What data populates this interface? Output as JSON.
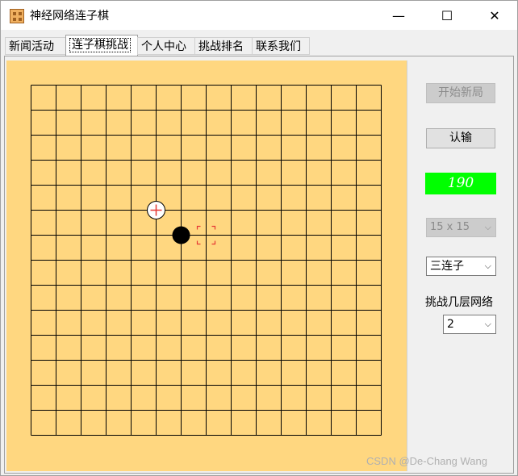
{
  "window": {
    "title": "神经网络连子棋",
    "minimize_symbol": "—",
    "maximize_symbol": "☐",
    "close_symbol": "✕",
    "app_icon": "grid-board-icon"
  },
  "tabs": [
    {
      "label": "新闻活动",
      "active": false
    },
    {
      "label": "连子棋挑战",
      "active": true
    },
    {
      "label": "个人中心",
      "active": false
    },
    {
      "label": "挑战排名",
      "active": false
    },
    {
      "label": "联系我们",
      "active": false
    }
  ],
  "board": {
    "size": 15,
    "lines": 15,
    "background_color": "#ffd780",
    "stones": [
      {
        "color": "white",
        "col": 5,
        "row": 5,
        "marker": "last-move-cross"
      },
      {
        "color": "black",
        "col": 6,
        "row": 6
      }
    ],
    "cursor": {
      "col": 7,
      "row": 6,
      "color": "#e53935"
    }
  },
  "controls": {
    "new_game_label": "开始新局",
    "new_game_enabled": false,
    "resign_label": "认输",
    "resign_enabled": true,
    "status_text": "190",
    "status_color": "#00ff00",
    "board_size_select": {
      "value": "15 x 15",
      "enabled": false
    },
    "win_length_select": {
      "value": "三连子",
      "enabled": true
    },
    "network_label": "挑战几层网络",
    "network_select": {
      "value": "2",
      "enabled": true
    }
  },
  "watermark": "CSDN @De-Chang Wang"
}
